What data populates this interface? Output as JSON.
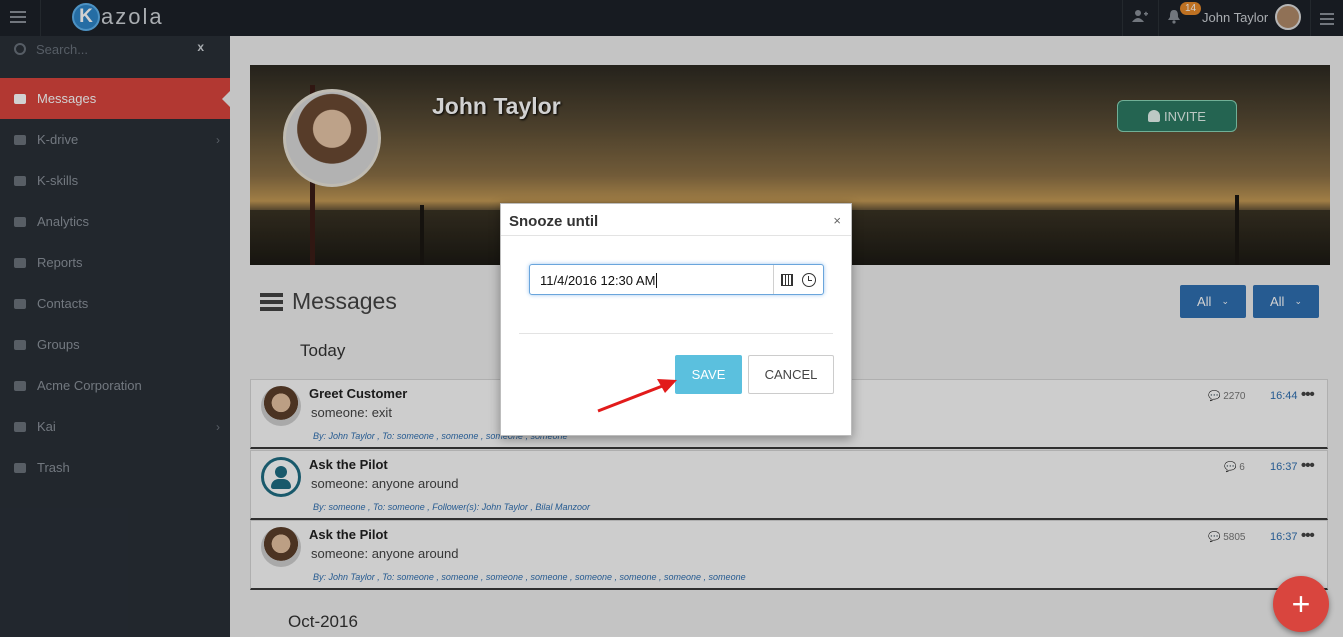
{
  "app": {
    "brand_initial": "K",
    "brand_rest": "azola"
  },
  "topbar": {
    "notification_count": "14",
    "user_name": "John Taylor"
  },
  "sidebar": {
    "search_placeholder": "Search...",
    "search_clear": "x",
    "items": [
      {
        "label": "Messages",
        "icon": "inbox-icon",
        "active": true
      },
      {
        "label": "K-drive",
        "icon": "drive-icon",
        "has_submenu": true
      },
      {
        "label": "K-skills",
        "icon": "laptop-icon"
      },
      {
        "label": "Analytics",
        "icon": "bar-chart-icon"
      },
      {
        "label": "Reports",
        "icon": "table-icon"
      },
      {
        "label": "Contacts",
        "icon": "user-icon"
      },
      {
        "label": "Groups",
        "icon": "users-icon"
      },
      {
        "label": "Acme Corporation",
        "icon": "sitemap-icon"
      },
      {
        "label": "Kai",
        "icon": "laptop-icon",
        "has_submenu": true
      },
      {
        "label": "Trash",
        "icon": "trash-icon"
      }
    ]
  },
  "profile": {
    "name": "John Taylor",
    "invite_label": "INVITE"
  },
  "messages": {
    "title": "Messages",
    "filters": [
      "All",
      "All"
    ],
    "group_today": "Today",
    "group_oct": "Oct-2016",
    "items": [
      {
        "title": "Greet Customer",
        "preview": "someone: exit",
        "meta": "By:  John Taylor ,   To: someone , someone , someone , someone",
        "count": "2270",
        "time": "16:44",
        "avatar": "photo"
      },
      {
        "title": "Ask the Pilot",
        "preview": "someone: anyone around",
        "meta": "By:  someone ,   To: someone ,   Follower(s):  John Taylor , Bilal Manzoor",
        "count": "6",
        "time": "16:37",
        "avatar": "default"
      },
      {
        "title": "Ask the Pilot",
        "preview": "someone: anyone around",
        "meta": "By:  John Taylor ,   To: someone , someone , someone , someone , someone , someone , someone , someone",
        "count": "5805",
        "time": "16:37",
        "avatar": "photo"
      }
    ],
    "more_glyph": "•••"
  },
  "fab": {
    "label": "+"
  },
  "modal": {
    "title": "Snooze until",
    "close": "×",
    "datetime_value": "11/4/2016 12:30 AM",
    "save_label": "SAVE",
    "cancel_label": "CANCEL"
  },
  "colors": {
    "accent_red": "#d9453e",
    "sidebar_bg": "#2a3038",
    "save_blue": "#5bc0de",
    "filter_blue": "#2f6fb1",
    "invite_green": "#2d7a63"
  }
}
